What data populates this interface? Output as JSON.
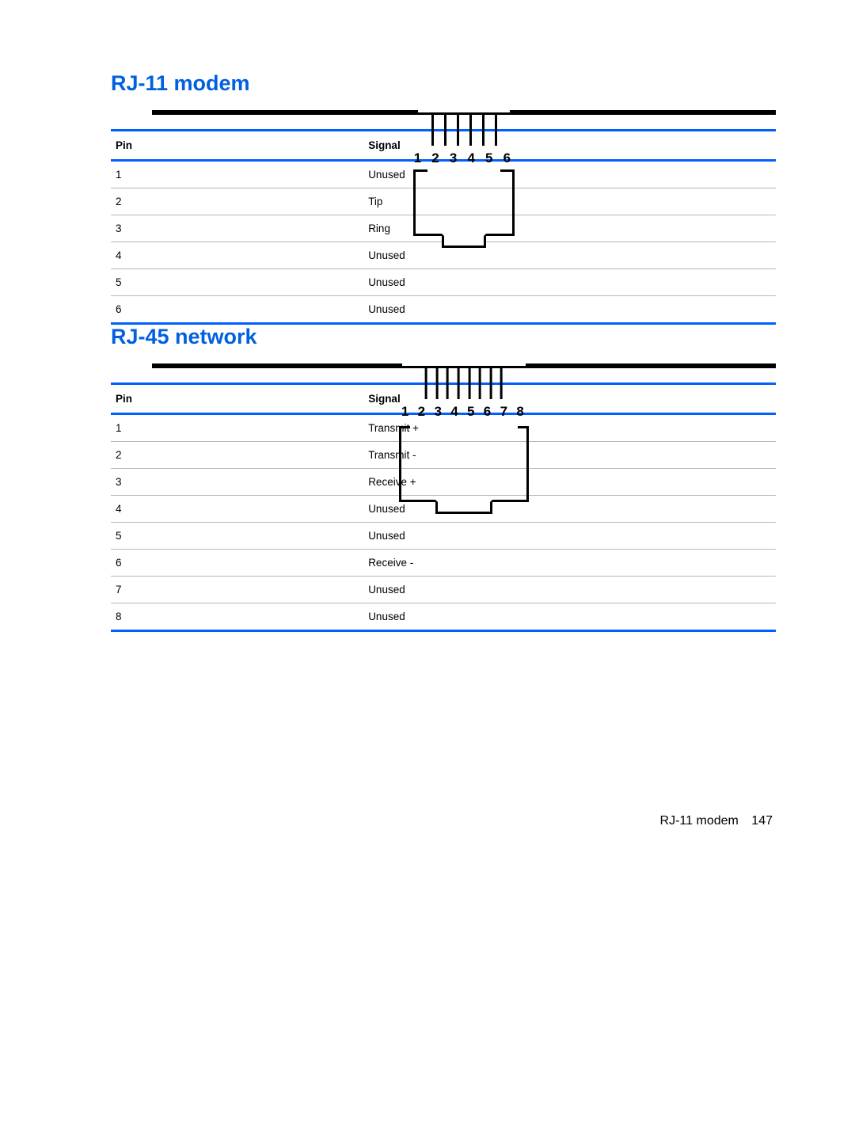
{
  "section1": {
    "heading": "RJ-11 modem",
    "pin_labels": "1 2 3 4 5 6",
    "table": {
      "headers": {
        "pin": "Pin",
        "signal": "Signal"
      },
      "rows": [
        {
          "pin": "1",
          "signal": "Unused"
        },
        {
          "pin": "2",
          "signal": "Tip"
        },
        {
          "pin": "3",
          "signal": "Ring"
        },
        {
          "pin": "4",
          "signal": "Unused"
        },
        {
          "pin": "5",
          "signal": "Unused"
        },
        {
          "pin": "6",
          "signal": "Unused"
        }
      ]
    }
  },
  "section2": {
    "heading": "RJ-45 network",
    "pin_labels": "1 2 3 4 5 6 7 8",
    "table": {
      "headers": {
        "pin": "Pin",
        "signal": "Signal"
      },
      "rows": [
        {
          "pin": "1",
          "signal": "Transmit +"
        },
        {
          "pin": "2",
          "signal": "Transmit -"
        },
        {
          "pin": "3",
          "signal": "Receive +"
        },
        {
          "pin": "4",
          "signal": "Unused"
        },
        {
          "pin": "5",
          "signal": "Unused"
        },
        {
          "pin": "6",
          "signal": "Receive -"
        },
        {
          "pin": "7",
          "signal": "Unused"
        },
        {
          "pin": "8",
          "signal": "Unused"
        }
      ]
    }
  },
  "footer": {
    "text": "RJ-11 modem",
    "page_number": "147"
  }
}
